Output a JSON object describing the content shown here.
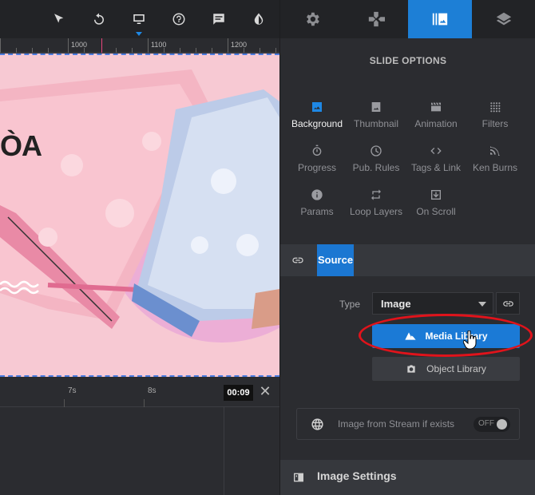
{
  "editor": {
    "ruler": {
      "marks": [
        "1000",
        "1100",
        "1200"
      ]
    },
    "canvas": {
      "headline": "ÒA"
    },
    "timeline": {
      "marks": [
        "7s",
        "8s"
      ],
      "current_time": "00:09",
      "close_glyph": "✕"
    }
  },
  "toolbar": {
    "icons": [
      "pointer-icon",
      "undo-icon",
      "desktop-icon",
      "help-icon",
      "comment-icon",
      "contrast-icon"
    ]
  },
  "sidebar": {
    "tabs": [
      "gear-icon",
      "gamepad-icon",
      "slide-library-icon",
      "layers-icon"
    ],
    "active_tab": 2,
    "title": "SLIDE OPTIONS",
    "options": [
      {
        "label": "Background",
        "icon": "image-icon",
        "active": true
      },
      {
        "label": "Thumbnail",
        "icon": "thumbnail-icon"
      },
      {
        "label": "Animation",
        "icon": "clapper-icon"
      },
      {
        "label": "Filters",
        "icon": "dots-grid-icon"
      },
      {
        "label": "Progress",
        "icon": "stopwatch-icon"
      },
      {
        "label": "Pub. Rules",
        "icon": "clock-icon"
      },
      {
        "label": "Tags & Link",
        "icon": "code-icon"
      },
      {
        "label": "Ken Burns",
        "icon": "ken-burns-icon"
      },
      {
        "label": "Params",
        "icon": "info-icon"
      },
      {
        "label": "Loop Layers",
        "icon": "loop-icon"
      },
      {
        "label": "On Scroll",
        "icon": "scroll-icon"
      }
    ],
    "source": {
      "label": "Source"
    },
    "type": {
      "label": "Type",
      "value": "Image"
    },
    "media_library_button": "Media Library",
    "object_library_button": "Object Library",
    "stream": {
      "label": "Image from Stream if exists",
      "toggle": "OFF"
    },
    "image_settings": "Image Settings"
  },
  "colors": {
    "accent": "#1b7ad6",
    "highlight": "#e0131b",
    "canvas_bg": "#f7c9d3"
  }
}
